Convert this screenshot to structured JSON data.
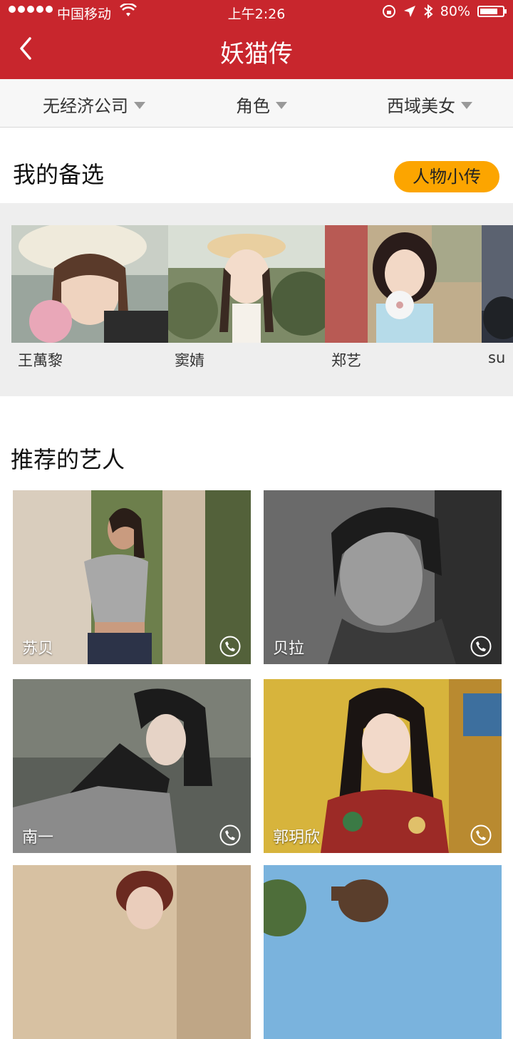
{
  "status_bar": {
    "carrier": "中国移动",
    "time": "上午2:26",
    "battery_text": "80%",
    "battery_level": 0.8
  },
  "nav": {
    "title": "妖猫传"
  },
  "filters": [
    {
      "label": "无经济公司"
    },
    {
      "label": "角色"
    },
    {
      "label": "西域美女"
    }
  ],
  "shortlist": {
    "title": "我的备选",
    "button": "人物小传",
    "items": [
      {
        "name": "王萬黎"
      },
      {
        "name": "窦婧"
      },
      {
        "name": "郑艺"
      },
      {
        "name": "su"
      }
    ]
  },
  "recommended": {
    "title": "推荐的艺人",
    "cards": [
      {
        "name": "苏贝"
      },
      {
        "name": "贝拉"
      },
      {
        "name": "南一"
      },
      {
        "name": "郭玥欣"
      },
      {
        "name": ""
      },
      {
        "name": ""
      }
    ]
  },
  "colors": {
    "brand_red": "#c8262d",
    "accent_orange": "#fca500"
  }
}
